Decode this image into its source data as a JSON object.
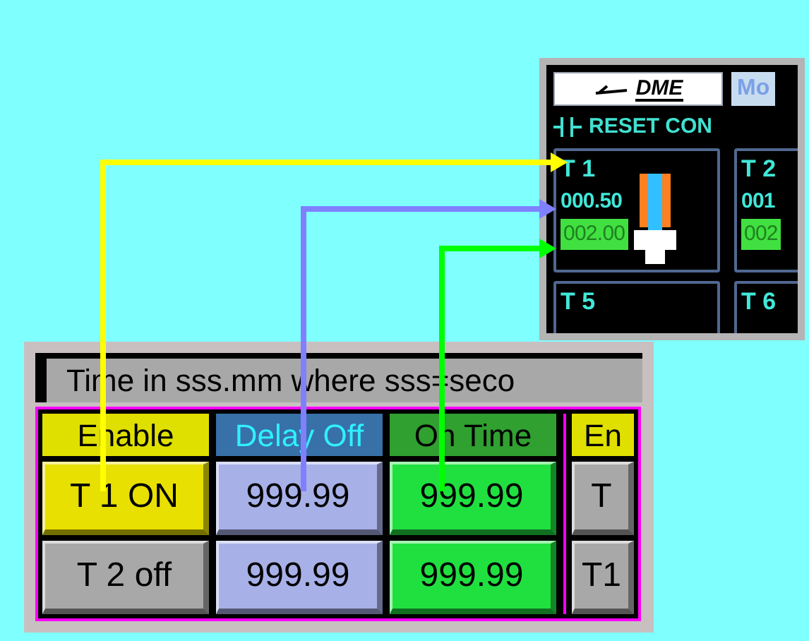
{
  "controller_panel": {
    "logo": "DME",
    "tab": "Mo",
    "reset_label": "RESET CON",
    "timers": [
      {
        "label": "T 1",
        "delay": "000.50",
        "on_time": "002.00",
        "valve": true
      },
      {
        "label": "T 2",
        "delay": "001",
        "on_time": "002",
        "valve": false
      },
      {
        "label": "T 5",
        "valve": false
      },
      {
        "label": "T 6",
        "valve": false
      }
    ]
  },
  "settings_panel": {
    "caption": "Time in sss.mm where sss=seco",
    "columns": [
      {
        "label": "Enable",
        "kind": "enable"
      },
      {
        "label": "Delay Off",
        "kind": "delay"
      },
      {
        "label": "On Time",
        "kind": "on_time"
      },
      {
        "label": "En",
        "kind": "enable"
      }
    ],
    "rows": [
      [
        {
          "text": "T 1 ON",
          "on": true
        },
        {
          "text": "999.99"
        },
        {
          "text": "999.99"
        },
        {
          "text": "T",
          "on": false
        }
      ],
      [
        {
          "text": "T 2 off",
          "on": false
        },
        {
          "text": "999.99"
        },
        {
          "text": "999.99"
        },
        {
          "text": "T1",
          "on": false
        }
      ]
    ]
  },
  "arrows": [
    {
      "color": "#ffff00"
    },
    {
      "color": "#8080ff"
    },
    {
      "color": "#00ff00"
    }
  ]
}
